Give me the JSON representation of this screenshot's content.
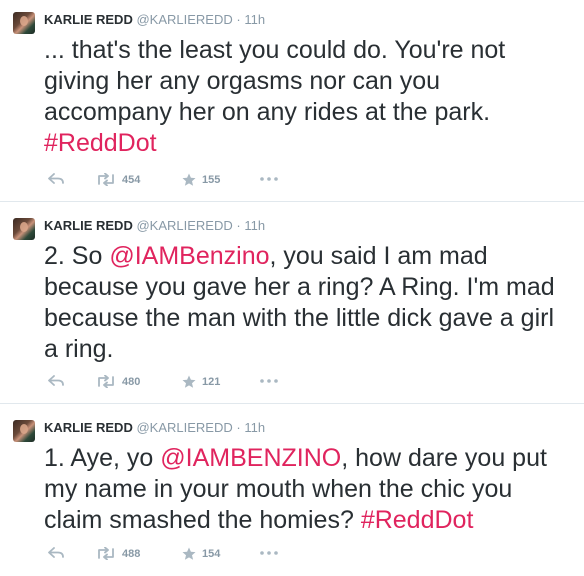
{
  "tweets": [
    {
      "name": "KARLIE REDD",
      "handle": "@KARLIEREDD",
      "dot": "·",
      "time": "11h",
      "text_parts": [
        {
          "t": "... that's the least you could do. You're not giving her any orgasms nor can you accompany her on any rides at the park. ",
          "c": ""
        },
        {
          "t": "#ReddDot",
          "c": "hl"
        }
      ],
      "retweets": "454",
      "favorites": "155"
    },
    {
      "name": "KARLIE REDD",
      "handle": "@KARLIEREDD",
      "dot": "·",
      "time": "11h",
      "text_parts": [
        {
          "t": "2. So ",
          "c": ""
        },
        {
          "t": "@IAMBenzino",
          "c": "hl"
        },
        {
          "t": ", you said I am mad because you gave her a ring? A Ring. I'm mad because the man with the little dick gave a girl a ring.",
          "c": ""
        }
      ],
      "retweets": "480",
      "favorites": "121"
    },
    {
      "name": "KARLIE REDD",
      "handle": "@KARLIEREDD",
      "dot": "·",
      "time": "11h",
      "text_parts": [
        {
          "t": "1. Aye, yo ",
          "c": ""
        },
        {
          "t": "@IAMBENZINO",
          "c": "hl"
        },
        {
          "t": ", how dare you put my name in your mouth when the chic you claim smashed the homies? ",
          "c": ""
        },
        {
          "t": "#ReddDot",
          "c": "hl"
        }
      ],
      "retweets": "488",
      "favorites": "154"
    }
  ],
  "icons": {
    "reply": "reply-icon",
    "retweet": "retweet-icon",
    "favorite": "favorite-star-icon",
    "more": "more-dots-icon"
  },
  "colors": {
    "accent": "#e0245e",
    "muted": "#8899a6",
    "text": "#292f33"
  }
}
